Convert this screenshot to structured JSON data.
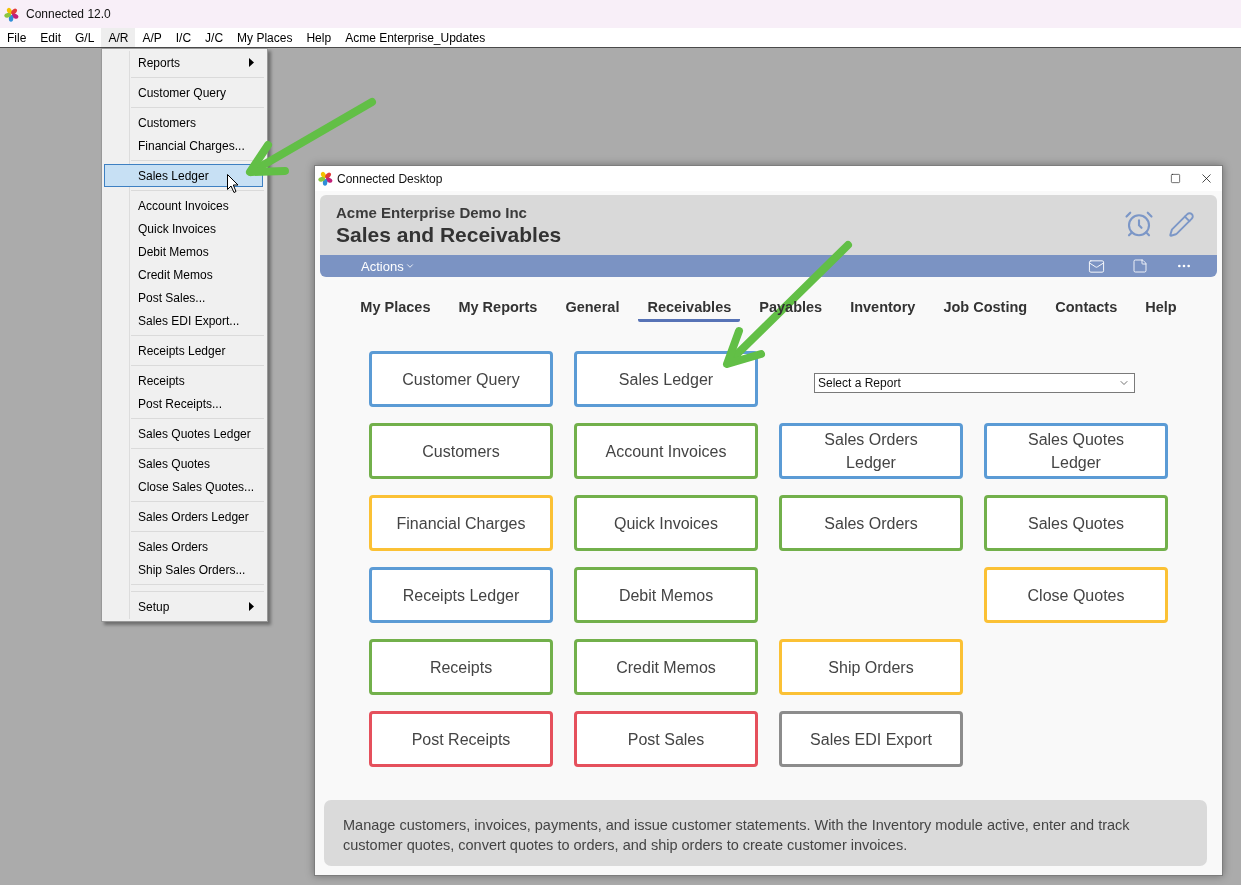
{
  "app": {
    "title": "Connected 12.0"
  },
  "menu_bar": [
    {
      "label": "File",
      "selected": false
    },
    {
      "label": "Edit",
      "selected": false
    },
    {
      "label": "G/L",
      "selected": false
    },
    {
      "label": "A/R",
      "selected": true
    },
    {
      "label": "A/P",
      "selected": false
    },
    {
      "label": "I/C",
      "selected": false
    },
    {
      "label": "J/C",
      "selected": false
    },
    {
      "label": "My Places",
      "selected": false
    },
    {
      "label": "Help",
      "selected": false
    },
    {
      "label": "Acme Enterprise_Updates",
      "selected": false
    }
  ],
  "dropdown_menu": {
    "items": [
      {
        "kind": "submenu",
        "label": "Reports",
        "selected": false
      },
      {
        "kind": "separator"
      },
      {
        "kind": "item",
        "label": "Customer Query",
        "selected": false
      },
      {
        "kind": "separator"
      },
      {
        "kind": "item",
        "label": "Customers",
        "selected": false
      },
      {
        "kind": "item",
        "label": "Financial Charges...",
        "selected": false
      },
      {
        "kind": "separator"
      },
      {
        "kind": "item",
        "label": "Sales Ledger",
        "selected": true
      },
      {
        "kind": "separator"
      },
      {
        "kind": "item",
        "label": "Account Invoices",
        "selected": false
      },
      {
        "kind": "item",
        "label": "Quick Invoices",
        "selected": false
      },
      {
        "kind": "item",
        "label": "Debit Memos",
        "selected": false
      },
      {
        "kind": "item",
        "label": "Credit Memos",
        "selected": false
      },
      {
        "kind": "item",
        "label": "Post Sales...",
        "selected": false
      },
      {
        "kind": "item",
        "label": "Sales EDI Export...",
        "selected": false
      },
      {
        "kind": "separator"
      },
      {
        "kind": "item",
        "label": "Receipts Ledger",
        "selected": false
      },
      {
        "kind": "separator"
      },
      {
        "kind": "item",
        "label": "Receipts",
        "selected": false
      },
      {
        "kind": "item",
        "label": "Post Receipts...",
        "selected": false
      },
      {
        "kind": "separator"
      },
      {
        "kind": "item",
        "label": "Sales Quotes Ledger",
        "selected": false
      },
      {
        "kind": "separator"
      },
      {
        "kind": "item",
        "label": "Sales Quotes",
        "selected": false
      },
      {
        "kind": "item",
        "label": "Close Sales Quotes...",
        "selected": false
      },
      {
        "kind": "separator"
      },
      {
        "kind": "item",
        "label": "Sales Orders Ledger",
        "selected": false
      },
      {
        "kind": "separator"
      },
      {
        "kind": "item",
        "label": "Sales Orders",
        "selected": false
      },
      {
        "kind": "item",
        "label": "Ship Sales Orders...",
        "selected": false
      },
      {
        "kind": "separator"
      },
      {
        "kind": "separator"
      },
      {
        "kind": "submenu",
        "label": "Setup",
        "selected": false
      }
    ]
  },
  "desktop_window": {
    "title": "Connected Desktop",
    "company": "Acme Enterprise Demo Inc",
    "page_title": "Sales and Receivables",
    "actions_label": "Actions",
    "tabs": [
      {
        "label": "My Places",
        "selected": false
      },
      {
        "label": "My Reports",
        "selected": false
      },
      {
        "label": "General",
        "selected": false
      },
      {
        "label": "Receivables",
        "selected": true
      },
      {
        "label": "Payables",
        "selected": false
      },
      {
        "label": "Inventory",
        "selected": false
      },
      {
        "label": "Job Costing",
        "selected": false
      },
      {
        "label": "Contacts",
        "selected": false
      },
      {
        "label": "Help",
        "selected": false
      }
    ],
    "grid": [
      {
        "cells": [
          {
            "kind": "button",
            "label": "Customer Query",
            "color": "#5b9bd5"
          },
          {
            "kind": "button",
            "label": "Sales Ledger",
            "color": "#5b9bd5"
          },
          {
            "kind": "select",
            "placeholder": "Select a Report"
          }
        ]
      },
      {
        "cells": [
          {
            "kind": "button",
            "label": "Customers",
            "color": "#72b04b"
          },
          {
            "kind": "button",
            "label": "Account Invoices",
            "color": "#72b04b"
          },
          {
            "kind": "button",
            "label": "Sales Orders Ledger",
            "color": "#5b9bd5"
          },
          {
            "kind": "button",
            "label": "Sales Quotes Ledger",
            "color": "#5b9bd5"
          }
        ]
      },
      {
        "cells": [
          {
            "kind": "button",
            "label": "Financial Charges",
            "color": "#fbc135"
          },
          {
            "kind": "button",
            "label": "Quick Invoices",
            "color": "#72b04b"
          },
          {
            "kind": "button",
            "label": "Sales Orders",
            "color": "#72b04b"
          },
          {
            "kind": "button",
            "label": "Sales Quotes",
            "color": "#72b04b"
          }
        ]
      },
      {
        "cells": [
          {
            "kind": "button",
            "label": "Receipts Ledger",
            "color": "#5b9bd5"
          },
          {
            "kind": "button",
            "label": "Debit Memos",
            "color": "#72b04b"
          },
          {
            "kind": "blank"
          },
          {
            "kind": "button",
            "label": "Close Quotes",
            "color": "#fbc135"
          }
        ]
      },
      {
        "cells": [
          {
            "kind": "button",
            "label": "Receipts",
            "color": "#72b04b"
          },
          {
            "kind": "button",
            "label": "Credit Memos",
            "color": "#72b04b"
          },
          {
            "kind": "button",
            "label": "Ship Orders",
            "color": "#fbc135"
          }
        ]
      },
      {
        "cells": [
          {
            "kind": "button",
            "label": "Post Receipts",
            "color": "#e5505c"
          },
          {
            "kind": "button",
            "label": "Post Sales",
            "color": "#e5505c"
          },
          {
            "kind": "button",
            "label": "Sales EDI Export",
            "color": "#8c8c8c"
          }
        ]
      }
    ],
    "description": "Manage customers, invoices, payments, and issue customer statements. With the Inventory module active, enter and track customer quotes, convert quotes to orders, and ship orders to create customer invoices."
  }
}
